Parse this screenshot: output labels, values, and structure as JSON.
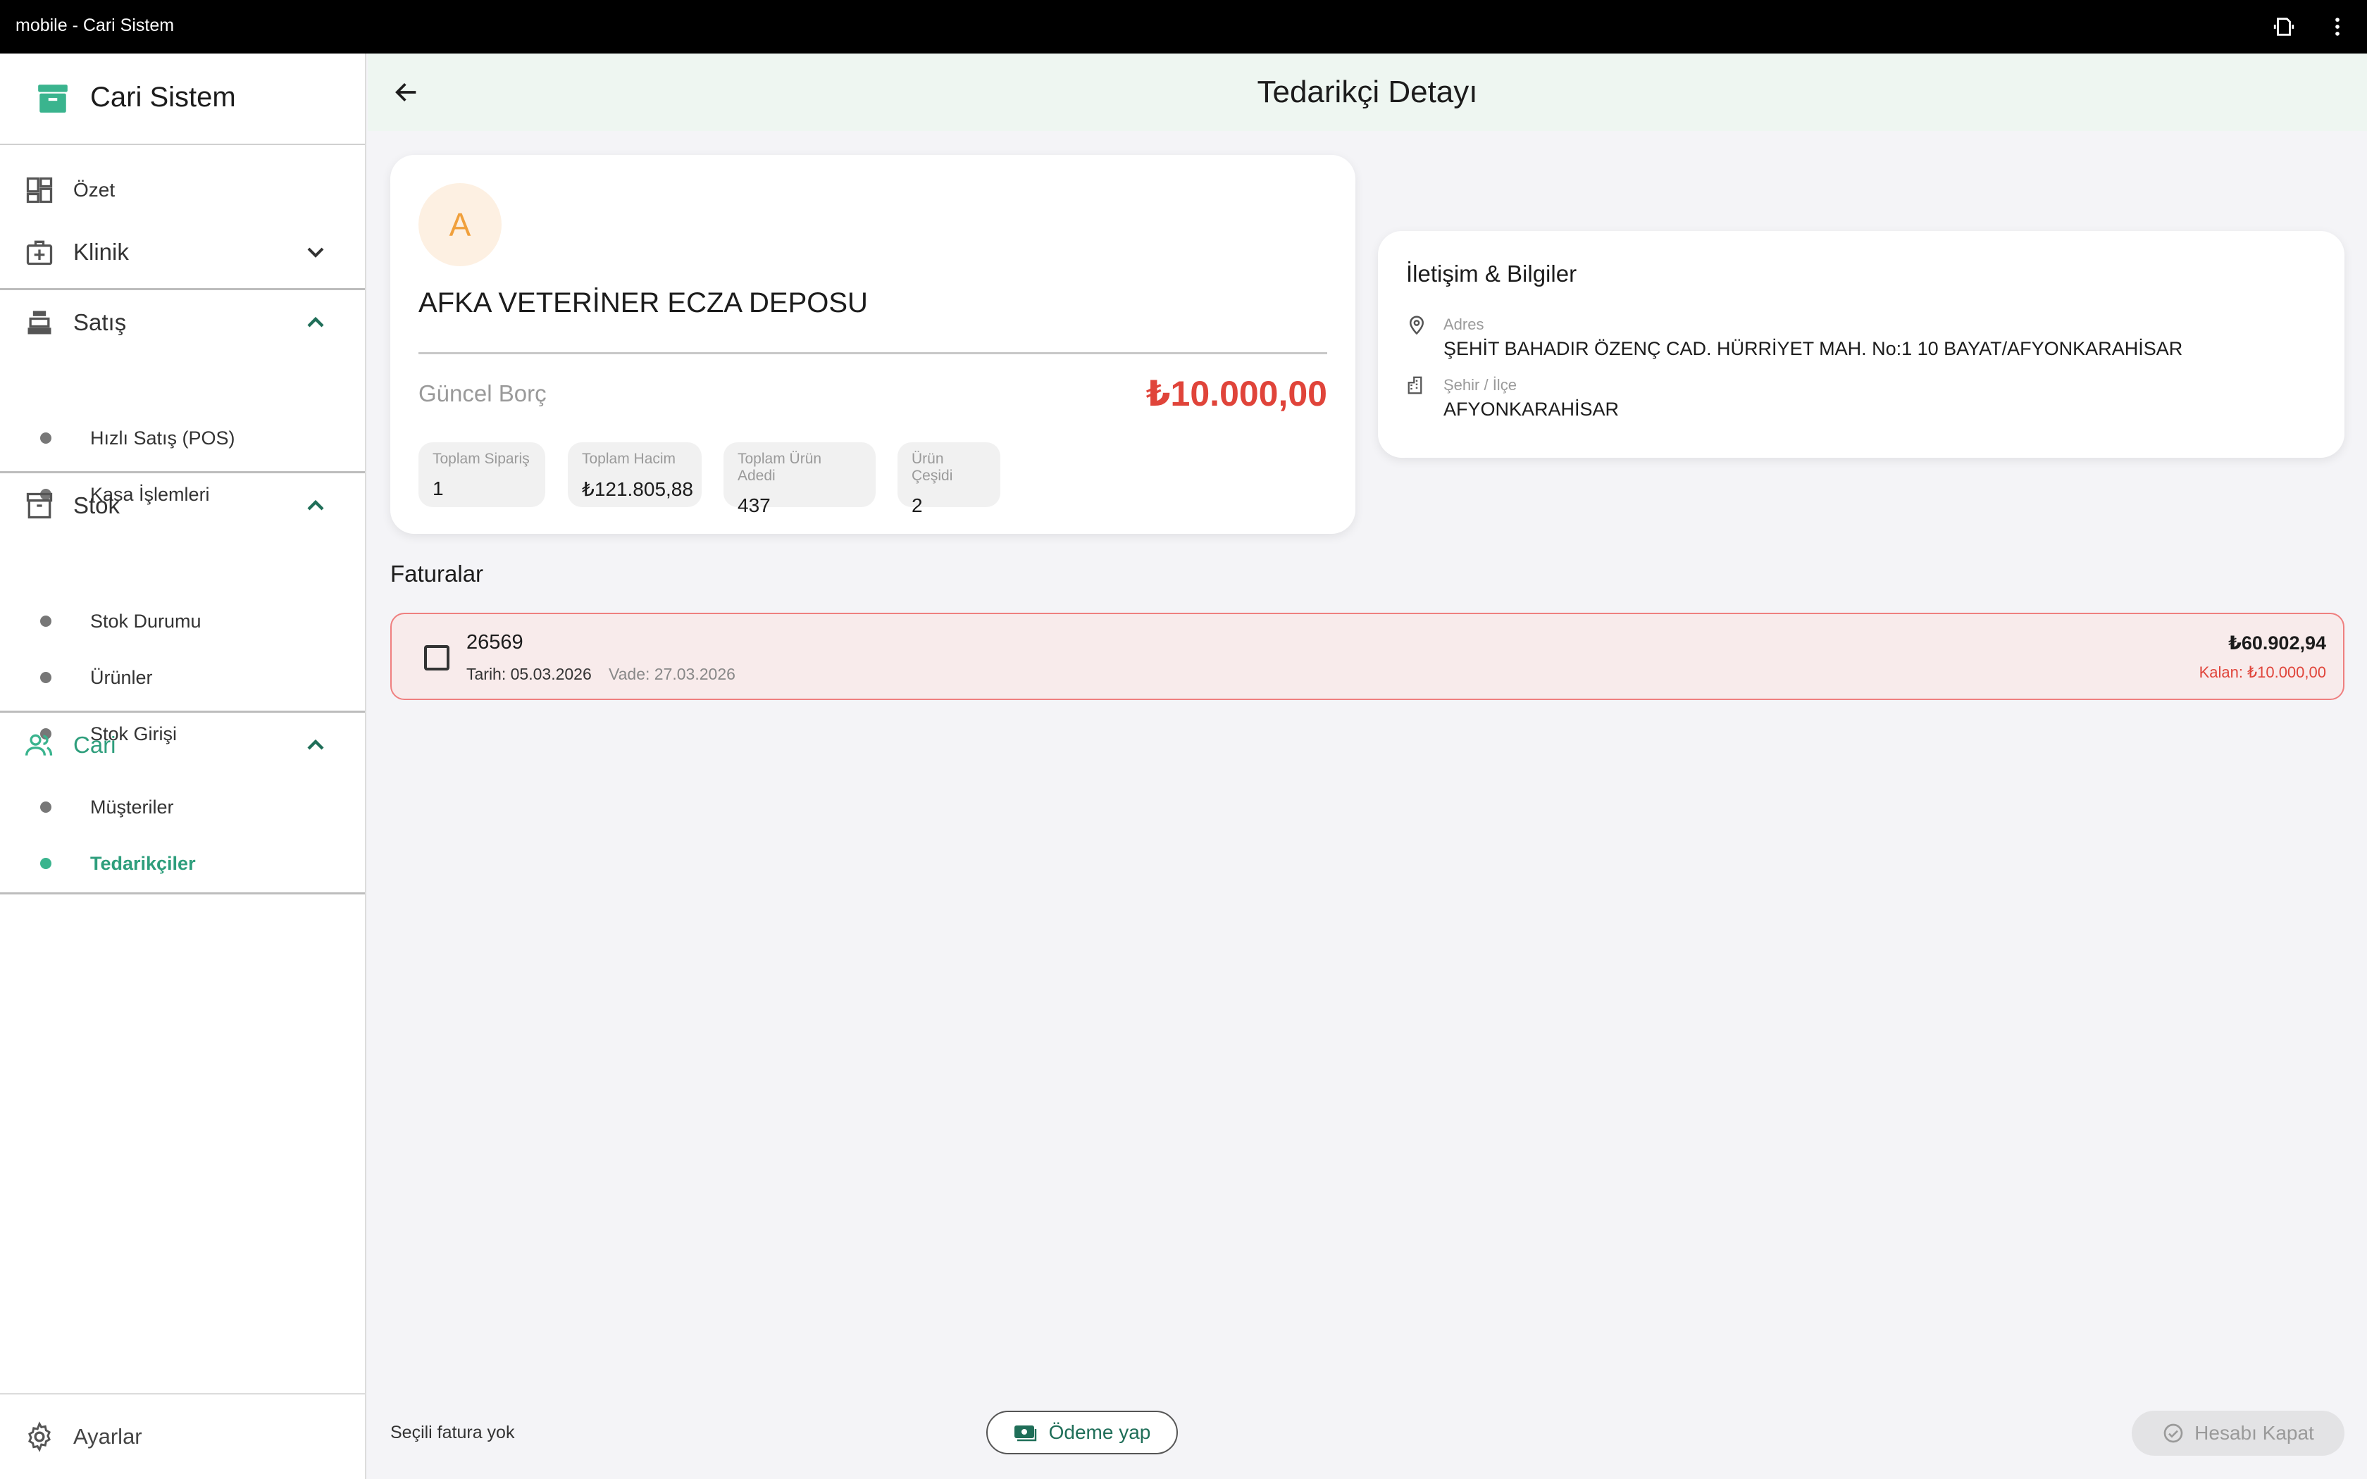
{
  "window": {
    "title": "mobile - Cari Sistem",
    "icons": [
      "rotate-icon",
      "more-vert-icon"
    ]
  },
  "sidebar": {
    "brand": "Cari Sistem",
    "ozet": "Özet",
    "klinik": "Klinik",
    "satis": {
      "label": "Satış",
      "items": [
        "Hızlı Satış (POS)",
        "Kasa İşlemleri"
      ]
    },
    "stok": {
      "label": "Stok",
      "items": [
        "Stok Durumu",
        "Ürünler",
        "Stok Girişi"
      ]
    },
    "cari": {
      "label": "Cari",
      "items": [
        "Müşteriler",
        "Tedarikçiler"
      ]
    },
    "settings": "Ayarlar",
    "accent_color": "#3ab48e"
  },
  "page": {
    "title": "Tedarikçi Detayı",
    "supplier": {
      "initial": "A",
      "name": "AFKA VETERİNER ECZA DEPOSU",
      "debt_label": "Güncel Borç",
      "debt_value": "₺10.000,00",
      "stats": [
        {
          "label": "Toplam Sipariş",
          "value": "1"
        },
        {
          "label": "Toplam Hacim",
          "value": "₺121.805,88"
        },
        {
          "label": "Toplam Ürün Adedi",
          "value": "437"
        },
        {
          "label": "Ürün Çeşidi",
          "value": "2"
        }
      ]
    },
    "contact": {
      "title": "İletişim & Bilgiler",
      "address_label": "Adres",
      "address": "ŞEHİT BAHADIR ÖZENÇ CAD. HÜRRİYET MAH. No:1 10 BAYAT/AFYONKARAHİSAR",
      "city_label": "Şehir / İlçe",
      "city": "AFYONKARAHİSAR"
    },
    "invoices_title": "Faturalar",
    "invoices": [
      {
        "number": "26569",
        "date": "Tarih: 05.03.2026",
        "due": "Vade: 27.03.2026",
        "total": "₺60.902,94",
        "remaining": "Kalan: ₺10.000,00"
      }
    ],
    "footer": {
      "selected_text": "Seçili fatura yok",
      "pay_label": "Ödeme yap",
      "close_label": "Hesabı Kapat"
    }
  }
}
